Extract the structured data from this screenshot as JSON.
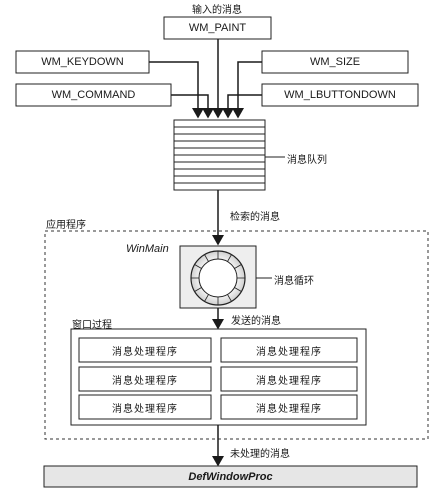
{
  "diagram": {
    "title_input": "输入的消息",
    "messages": {
      "paint": "WM_PAINT",
      "keydown": "WM_KEYDOWN",
      "size": "WM_SIZE",
      "command": "WM_COMMAND",
      "lbuttondown": "WM_LBUTTONDOWN"
    },
    "queue_label": "消息队列",
    "retrieved_label": "检索的消息",
    "application_label": "应用程序",
    "winmain_label": "WinMain",
    "loop_label": "消息循环",
    "sent_label": "发送的消息",
    "window_proc_label": "窗口过程",
    "handlers": [
      "消息处理程序",
      "消息处理程序",
      "消息处理程序",
      "消息处理程序",
      "消息处理程序",
      "消息处理程序"
    ],
    "unhandled_label": "未处理的消息",
    "defwindowproc": "DefWindowProc"
  }
}
